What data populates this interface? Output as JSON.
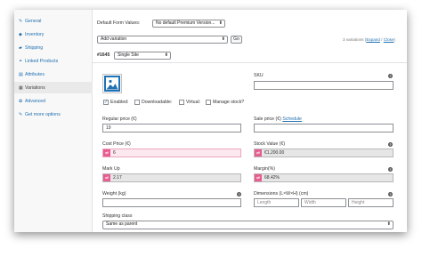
{
  "sidebar": {
    "items": [
      {
        "label": "General",
        "icon": "wrench-icon",
        "glyph": "✎"
      },
      {
        "label": "Inventory",
        "icon": "box-icon",
        "glyph": "◆"
      },
      {
        "label": "Shipping",
        "icon": "truck-icon",
        "glyph": "▰"
      },
      {
        "label": "Linked Products",
        "icon": "link-icon",
        "glyph": "⚭"
      },
      {
        "label": "Attributes",
        "icon": "list-icon",
        "glyph": "▤"
      },
      {
        "label": "Variations",
        "icon": "grid-icon",
        "glyph": "▦"
      },
      {
        "label": "Advanced",
        "icon": "gear-icon",
        "glyph": "✿"
      },
      {
        "label": "Get more options",
        "icon": "plugin-icon",
        "glyph": "✎"
      }
    ],
    "active_index": 5
  },
  "defaults": {
    "label": "Default Form Values:",
    "value": "No default Premium Version..."
  },
  "variation_bar": {
    "select_value": "Add variation",
    "go_label": "Go",
    "count_text": "3 variations",
    "expand_label": "Expand",
    "separator": "/",
    "close_label": "Close",
    "open_paren": "(",
    "close_paren": ")"
  },
  "variation": {
    "id_label": "#1645",
    "type_value": "Single Site"
  },
  "sku": {
    "label": "SKU",
    "value": ""
  },
  "options": {
    "enabled": {
      "label": "Enabled:",
      "checked": true
    },
    "downloadable": {
      "label": "Downloadable:",
      "checked": false
    },
    "virtual": {
      "label": "Virtual:",
      "checked": false
    },
    "manage_stock": {
      "label": "Manage stock?",
      "checked": false
    }
  },
  "pricing": {
    "regular_label": "Regular price (€)",
    "regular_value": "19",
    "sale_label": "Sale price (€)",
    "schedule_label": "Schedule",
    "sale_value": ""
  },
  "cost": {
    "cost_label": "Cost Price (€)",
    "cost_value": "6",
    "stock_label": "Stock Value (€)",
    "stock_value": "€1,200.00",
    "markup_label": "Mark Up",
    "markup_value": "2.17",
    "margin_label": "Margin(%)",
    "margin_value": "68.42%"
  },
  "dimensions": {
    "weight_label": "Weight (kg)",
    "weight_value": "",
    "dims_label": "Dimensions (L×W×H) (cm)",
    "length_placeholder": "Length",
    "width_placeholder": "Width",
    "height_placeholder": "Height"
  },
  "shipping": {
    "label": "Shipping class",
    "value": "Same as parent"
  },
  "colors": {
    "link": "#2271b1",
    "pink_field": "#fde8ef",
    "pink_tag": "#e85d91",
    "grey_field": "#e6e6e6"
  }
}
